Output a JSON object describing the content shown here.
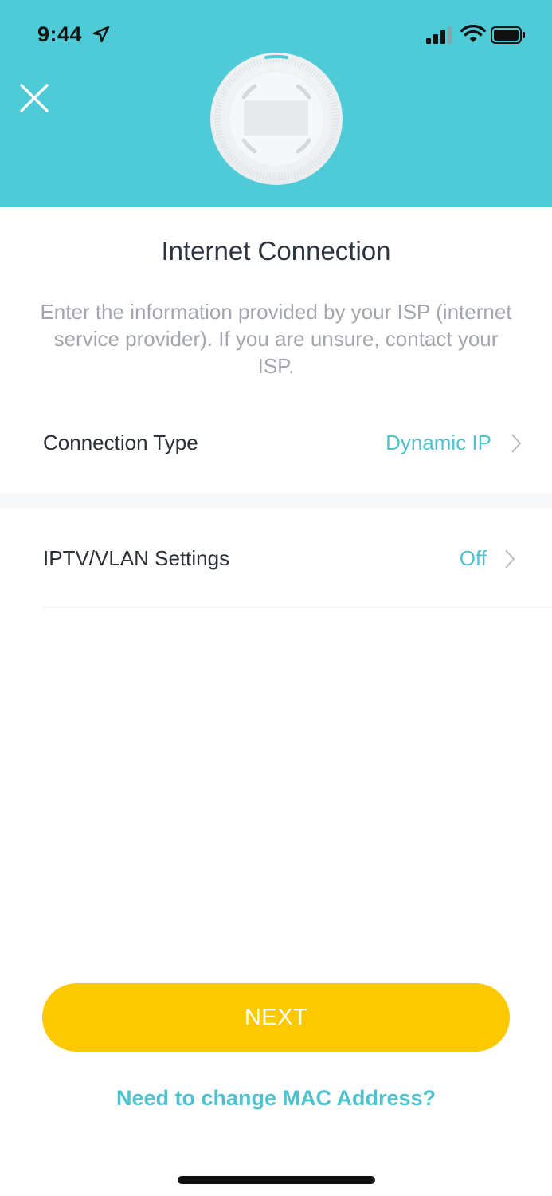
{
  "status_bar": {
    "time": "9:44",
    "icons": [
      "location-arrow-icon",
      "signal-icon",
      "wifi-icon",
      "battery-icon"
    ]
  },
  "header": {
    "close_icon": "close-icon",
    "device_image": "router-device-image"
  },
  "main": {
    "title": "Internet Connection",
    "description": "Enter the information provided by your ISP (internet service provider). If you are unsure, contact your ISP."
  },
  "settings": {
    "connection_type": {
      "label": "Connection Type",
      "value": "Dynamic IP"
    },
    "iptv_vlan": {
      "label": "IPTV/VLAN Settings",
      "value": "Off"
    }
  },
  "actions": {
    "next_label": "NEXT",
    "mac_link": "Need to change MAC Address?"
  },
  "colors": {
    "header_bg": "#4ecbd7",
    "accent": "#4ec3cf",
    "button_bg": "#fcc900",
    "text_primary": "#2b2f36",
    "text_secondary": "#a3a7ad"
  }
}
